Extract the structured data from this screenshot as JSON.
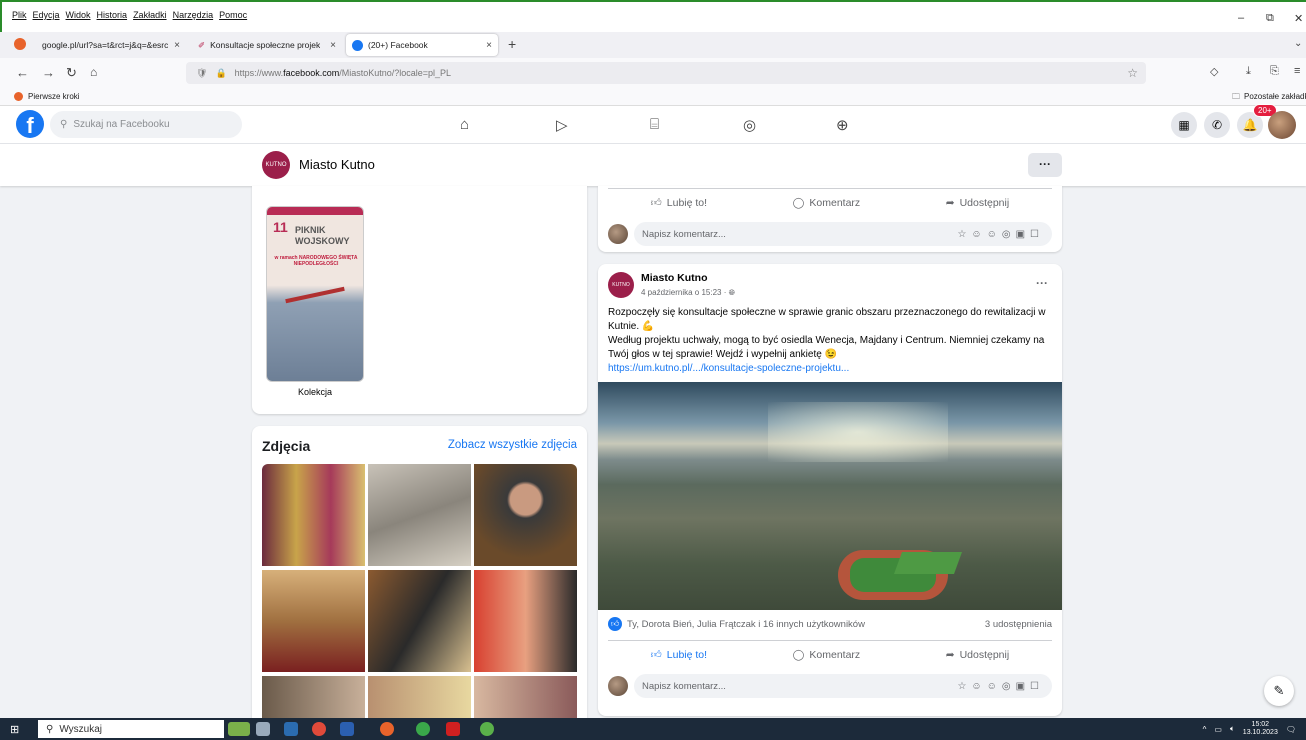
{
  "browser": {
    "menu": [
      "Plik",
      "Edycja",
      "Widok",
      "Historia",
      "Zakładki",
      "Narzędzia",
      "Pomoc"
    ],
    "tabs": [
      {
        "label": "google.pl/url?sa=t&rct=j&q=&esrc",
        "close": "×"
      },
      {
        "label": "Konsultacje społeczne projektu",
        "close": "×"
      },
      {
        "label": "(20+) Facebook",
        "close": "×"
      }
    ],
    "new_tab": "+",
    "url_prefix": "https://www.",
    "url_domain": "facebook.com",
    "url_rest": "/MiastoKutno/?locale=pl_PL",
    "bookmark_first": "Pierwsze kroki",
    "bookmark_other": "Pozostałe zakładki"
  },
  "facebook": {
    "logo": "f",
    "search_placeholder": "Szukaj na Facebooku",
    "notifications_badge": "20+",
    "page_logo_text": "KUTNO",
    "page_name": "Miasto Kutno",
    "page_more": "···"
  },
  "collection": {
    "poster_day": "11",
    "poster_title": "PIKNIK WOJSKOWY",
    "poster_subtitle": "w ramach NARODOWEGO ŚWIĘTA NIEPODLEGŁOŚCI",
    "label": "Kolekcja"
  },
  "photos": {
    "title": "Zdjęcia",
    "see_all": "Zobacz wszystkie zdjęcia"
  },
  "top_post": {
    "like": "Lubię to!",
    "comment": "Komentarz",
    "share": "Udostępnij",
    "comment_placeholder": "Napisz komentarz..."
  },
  "post": {
    "author": "Miasto Kutno",
    "date": "4 października o 15:23 · ",
    "more": "···",
    "text_1": "Rozpoczęły się konsultacje społeczne w sprawie granic obszaru przeznaczonego do rewitalizacji w Kutnie. 💪",
    "text_2": "Według projektu uchwały, mogą to być osiedla Wenecja, Majdany i Centrum. Niemniej czekamy na Twój głos w tej sprawie! Wejdź i wypełnij ankietę 😉",
    "link": "https://um.kutno.pl/.../konsultacje-spoleczne-projektu...",
    "reactions": "Ty, Dorota Bień, Julia Frątczak i 16 innych użytkowników",
    "shares": "3 udostępnienia",
    "like": "Lubię to!",
    "comment": "Komentarz",
    "share": "Udostępnij",
    "comment_placeholder": "Napisz komentarz..."
  },
  "taskbar": {
    "search": "Wyszukaj",
    "time": "15:02",
    "date": "13.10.2023"
  },
  "colors": {
    "facebook_blue": "#1877f2",
    "kutno_brand": "#9b1f4a",
    "taskbar": "#1c2a3a"
  },
  "icons": [
    "home-icon",
    "watch-icon",
    "marketplace-icon",
    "groups-icon",
    "gaming-icon",
    "menu-grid-icon",
    "messenger-icon",
    "bell-icon",
    "edit-icon"
  ]
}
